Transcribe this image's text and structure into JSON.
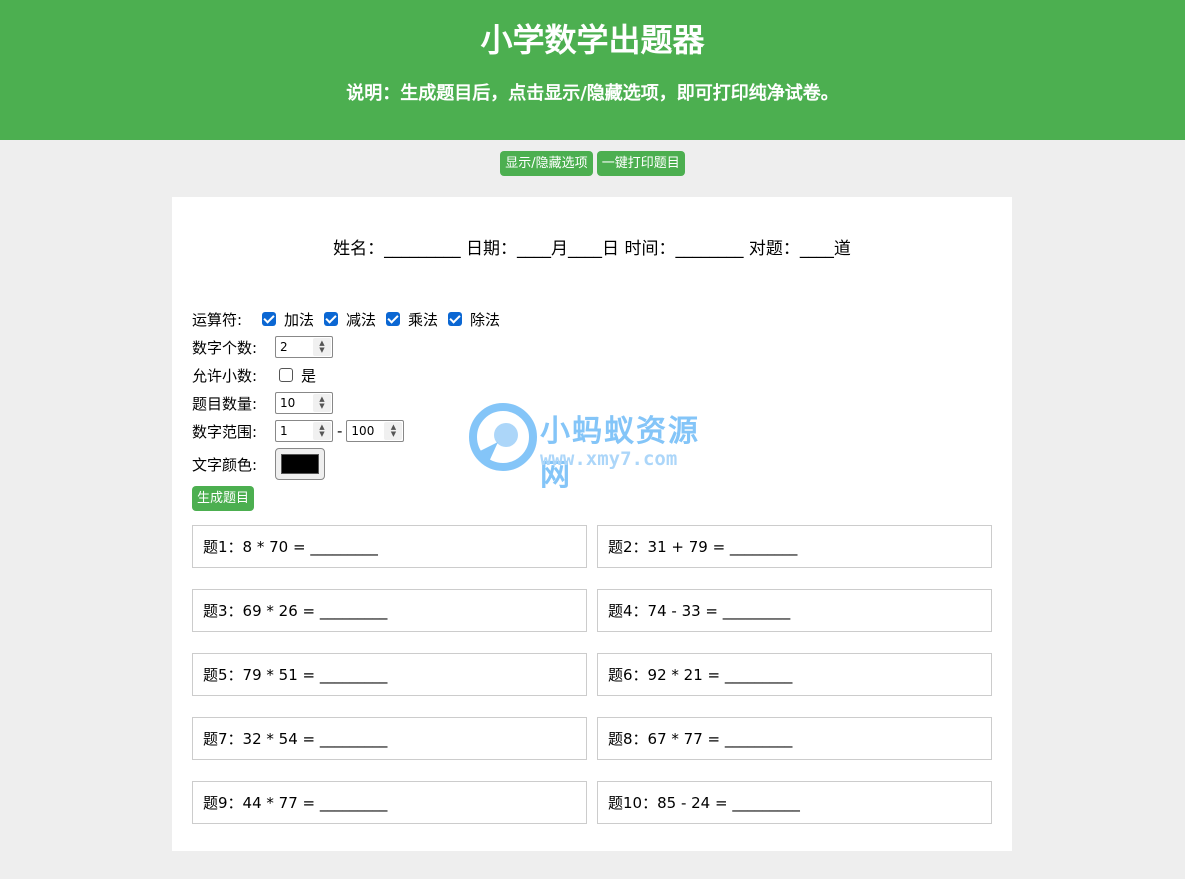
{
  "header": {
    "title": "小学数学出题器",
    "subtitle": "说明：生成题目后，点击显示/隐藏选项，即可打印纯净试卷。"
  },
  "toolbar": {
    "toggle_label": "显示/隐藏选项",
    "print_label": "一键打印题目"
  },
  "info_line": "姓名：_________ 日期：____月____日 时间：________ 对题：____道",
  "options": {
    "operator_label": "运算符:",
    "operators": [
      {
        "label": "加法",
        "checked": true
      },
      {
        "label": "减法",
        "checked": true
      },
      {
        "label": "乘法",
        "checked": true
      },
      {
        "label": "除法",
        "checked": true
      }
    ],
    "num_count_label": "数字个数:",
    "num_count_value": "2",
    "allow_decimal_label": "允许小数:",
    "allow_decimal_option": "是",
    "question_count_label": "题目数量:",
    "question_count_value": "10",
    "range_label": "数字范围:",
    "range_min": "1",
    "range_sep": "-",
    "range_max": "100",
    "color_label": "文字颜色:",
    "text_color": "#000000",
    "generate_label": "生成题目"
  },
  "questions": [
    "题1：8 * 70 = _________",
    "题2：31 + 79 = _________",
    "题3：69 * 26 = _________",
    "题4：74 - 33 = _________",
    "题5：79 * 51 = _________",
    "题6：92 * 21 = _________",
    "题7：32 * 54 = _________",
    "题8：67 * 77 = _________",
    "题9：44 * 77 = _________",
    "题10：85 - 24 = _________"
  ],
  "watermark": {
    "name": "小蚂蚁资源网",
    "url": "www.xmy7.com"
  },
  "colors": {
    "accent": "#4caf50",
    "checkbox": "#0b67d3",
    "background": "#eeeeee"
  }
}
